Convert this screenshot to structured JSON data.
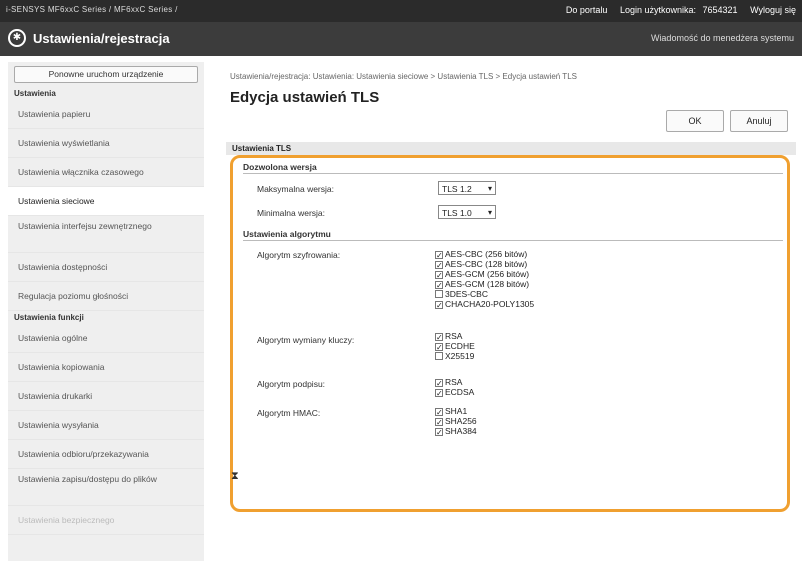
{
  "topbar": {
    "model": "i-SENSYS   MF6xxC Series / MF6xxC Series /",
    "portal_link": "Do portalu",
    "login_label": "Login użytkownika:",
    "login_user": "7654321",
    "logout": "Wyloguj się"
  },
  "header": {
    "title": "Ustawienia/rejestracja",
    "admin_message": "Wiadomość do menedżera systemu"
  },
  "sidebar": {
    "reboot_button": "Ponowne uruchom urządzenie",
    "section_settings": "Ustawienia",
    "items": [
      "Ustawienia papieru",
      "Ustawienia wyświetlania",
      "Ustawienia włącznika czasowego",
      "Ustawienia sieciowe",
      "Ustawienia interfejsu zewnętrznego",
      "Ustawienia dostępności",
      "Regulacja poziomu głośności"
    ],
    "section_functions": "Ustawienia funkcji",
    "func_items": [
      "Ustawienia ogólne",
      "Ustawienia kopiowania",
      "Ustawienia drukarki",
      "Ustawienia wysyłania",
      "Ustawienia odbioru/przekazywania",
      "Ustawienia zapisu/dostępu do plików",
      "Ustawienia bezpiecznego"
    ]
  },
  "main": {
    "breadcrumb": "Ustawienia/rejestracja: Ustawienia: Ustawienia sieciowe > Ustawienia TLS > Edycja ustawień TLS",
    "title": "Edycja ustawień TLS",
    "ok_button": "OK",
    "cancel_button": "Anuluj",
    "settings_header": "Ustawienia TLS",
    "allowed_version": "Dozwolona wersja",
    "max_version_label": "Maksymalna wersja:",
    "max_version_value": "TLS 1.2",
    "min_version_label": "Minimalna wersja:",
    "min_version_value": "TLS 1.0",
    "algorithm_settings": "Ustawienia algorytmu",
    "encryption_label": "Algorytm szyfrowania:",
    "encryption": [
      {
        "label": "AES-CBC (256 bitów)",
        "checked": true
      },
      {
        "label": "AES-CBC (128 bitów)",
        "checked": true
      },
      {
        "label": "AES-GCM (256 bitów)",
        "checked": true
      },
      {
        "label": "AES-GCM (128 bitów)",
        "checked": true
      },
      {
        "label": "3DES-CBC",
        "checked": false
      },
      {
        "label": "CHACHA20-POLY1305",
        "checked": true
      }
    ],
    "key_exchange_label": "Algorytm wymiany kluczy:",
    "key_exchange": [
      {
        "label": "RSA",
        "checked": true
      },
      {
        "label": "ECDHE",
        "checked": true
      },
      {
        "label": "X25519",
        "checked": false
      }
    ],
    "signature_label": "Algorytm podpisu:",
    "signature": [
      {
        "label": "RSA",
        "checked": true
      },
      {
        "label": "ECDSA",
        "checked": true
      }
    ],
    "hmac_label": "Algorytm HMAC:",
    "hmac": [
      {
        "label": "SHA1",
        "checked": true
      },
      {
        "label": "SHA256",
        "checked": true
      },
      {
        "label": "SHA384",
        "checked": true
      }
    ],
    "to_top": "⧗"
  },
  "colors": {
    "highlight": "#f0a030",
    "topbar": "#2b2b2b",
    "titlebar": "#3c3c3c"
  }
}
